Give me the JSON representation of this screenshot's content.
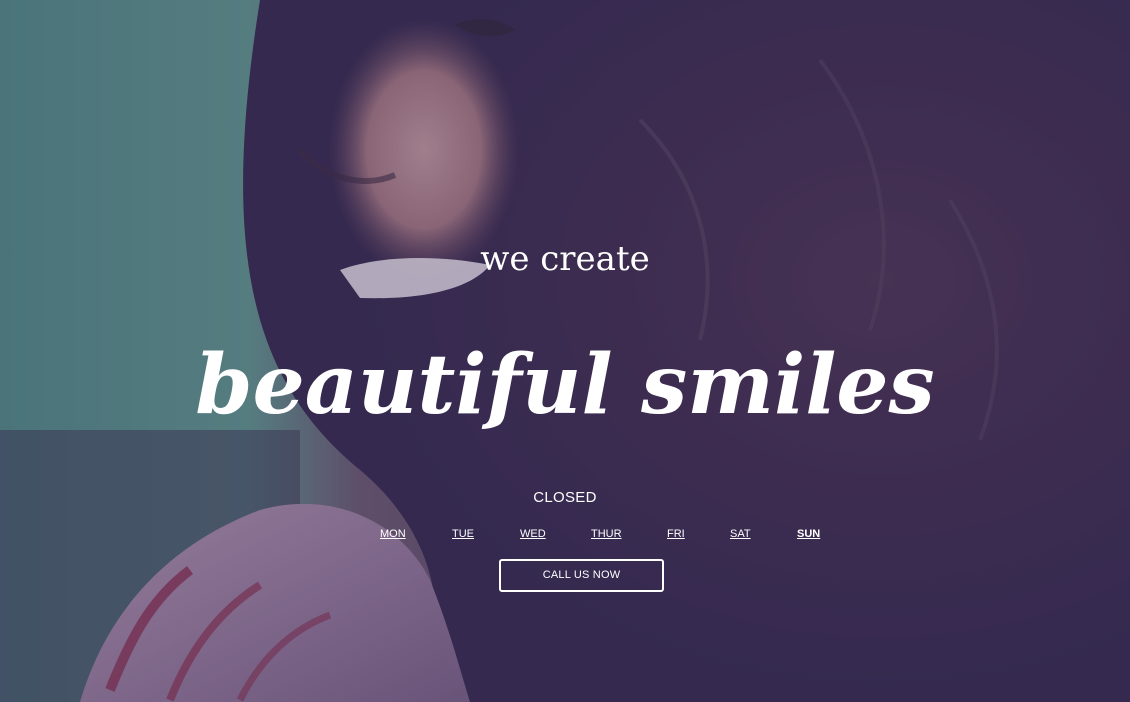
{
  "hero": {
    "tagline": "we create",
    "headline": "beautiful smiles",
    "status": "CLOSED",
    "days": [
      {
        "label": "MON",
        "active": false
      },
      {
        "label": "TUE",
        "active": false
      },
      {
        "label": "WED",
        "active": false
      },
      {
        "label": "THUR",
        "active": false
      },
      {
        "label": "FRI",
        "active": false
      },
      {
        "label": "SAT",
        "active": false
      },
      {
        "label": "SUN",
        "active": true
      }
    ],
    "cta_label": "CALL US NOW"
  },
  "colors": {
    "text": "#ffffff",
    "overlay": "#3c2d5f"
  }
}
